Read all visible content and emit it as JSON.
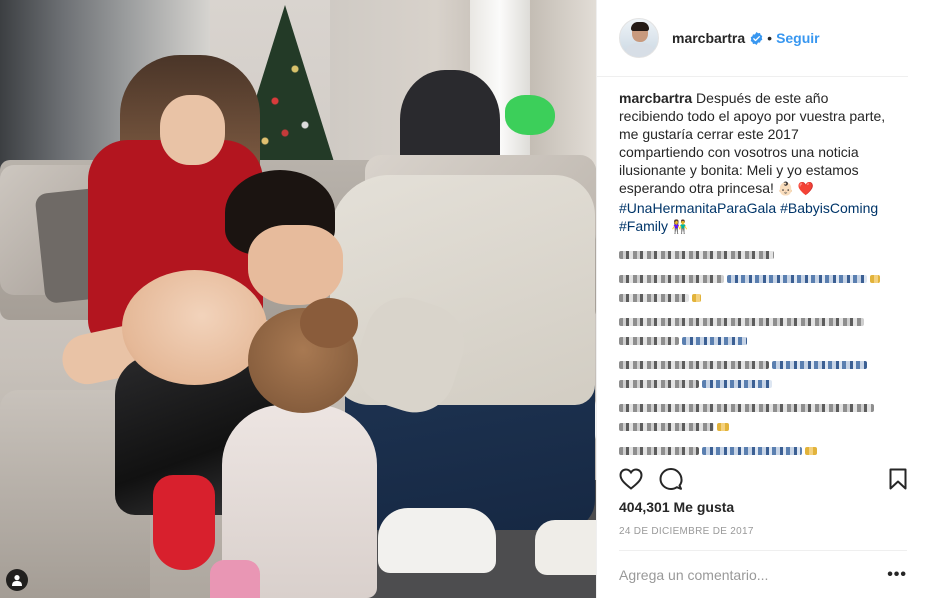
{
  "post": {
    "username": "marcbartra",
    "separator": "•",
    "follow_label": "Seguir",
    "caption": {
      "username": "marcbartra",
      "text": "Después de este año recibiendo todo el apoyo por vuestra parte, me gustaría cerrar este 2017 compartiendo con vosotros una noticia ilusionante y bonita: Meli y yo estamos esperando otra princesa!",
      "emoji_baby": "👶🏻",
      "emoji_heart": "❤️",
      "hashtags": [
        "#UnaHermanitaParaGala",
        "#BabyisComing",
        "#Family"
      ],
      "emoji_couple": "👫"
    },
    "likes_count": "404,301",
    "likes_label": "Me gusta",
    "date": "24 DE DICIEMBRE DE 2017",
    "comment_placeholder": "Agrega un comentario...",
    "more_label": "•••"
  },
  "icons": {
    "verified": "verified-badge-icon",
    "like": "heart-icon",
    "comment": "comment-bubble-icon",
    "save": "bookmark-icon",
    "tagged_users": "user-tag-icon"
  },
  "colors": {
    "link_blue": "#3897f0",
    "hashtag": "#003569",
    "text": "#262626",
    "muted": "#999999",
    "border": "#efefef"
  }
}
